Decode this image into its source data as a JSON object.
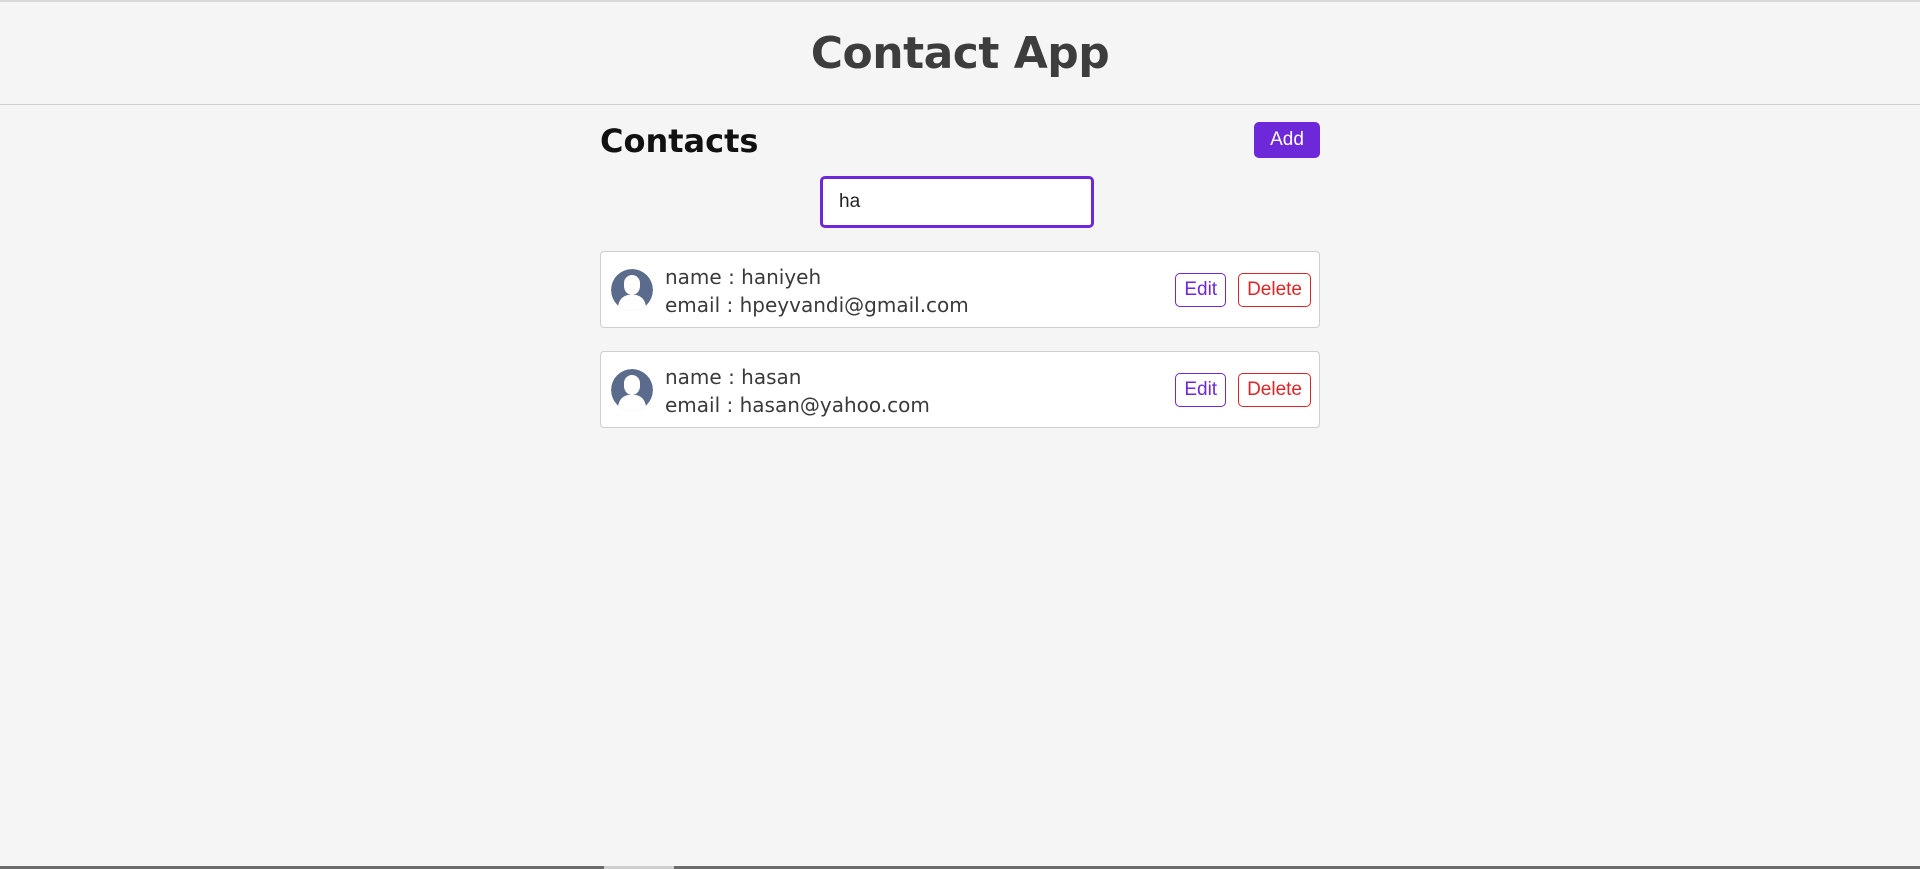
{
  "header": {
    "title": "Contact App"
  },
  "contacts_section": {
    "title": "Contacts",
    "add_label": "Add"
  },
  "search": {
    "value": "ha",
    "placeholder": ""
  },
  "contacts": [
    {
      "name_line": "name : haniyeh",
      "email_line": "email : hpeyvandi@gmail.com",
      "edit_label": "Edit",
      "delete_label": "Delete",
      "avatar_icon": "user-avatar-icon"
    },
    {
      "name_line": "name : hasan",
      "email_line": "email : hasan@yahoo.com",
      "edit_label": "Edit",
      "delete_label": "Delete",
      "avatar_icon": "user-avatar-icon"
    }
  ],
  "colors": {
    "accent": "#6d28d9",
    "danger": "#dc2626",
    "background": "#f5f5f5",
    "avatar": "#5a6b8c"
  }
}
